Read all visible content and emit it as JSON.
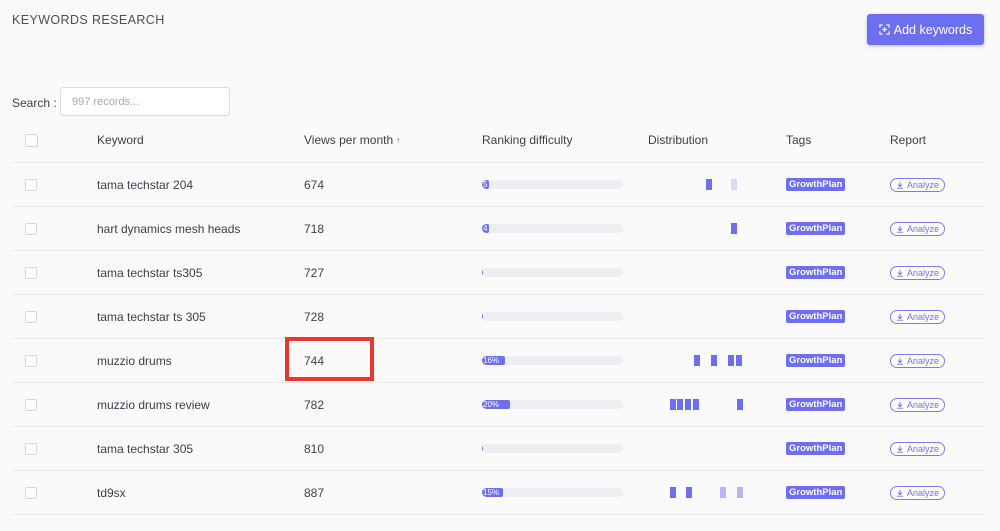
{
  "page": {
    "title": "KEYWORDS RESEARCH"
  },
  "toolbar": {
    "add_label": "Add keywords"
  },
  "search": {
    "label": "Search :",
    "placeholder": "997 records..."
  },
  "table": {
    "columns": {
      "keyword": "Keyword",
      "views": "Views per month",
      "views_sort": "↑",
      "ranking": "Ranking difficulty",
      "distribution": "Distribution",
      "tags": "Tags",
      "report": "Report"
    },
    "rows": [
      {
        "keyword": "tama techstar 204",
        "views": "674",
        "rank_value": 0.05,
        "rank_label": "5",
        "dist": [
          [
            226,
            "dark"
          ],
          [
            251,
            "lighter"
          ]
        ],
        "tag": "GrowthPlan",
        "report": "Analyze"
      },
      {
        "keyword": "hart dynamics mesh heads",
        "views": "718",
        "rank_value": 0.04,
        "rank_label": "4",
        "dist": [
          [
            251,
            "dark"
          ]
        ],
        "tag": "GrowthPlan",
        "report": "Analyze"
      },
      {
        "keyword": "tama techstar ts305",
        "views": "727",
        "rank_value": 0,
        "rank_label": "",
        "dist": [],
        "tag": "GrowthPlan",
        "report": "Analyze"
      },
      {
        "keyword": "tama techstar ts 305",
        "views": "728",
        "rank_value": 0,
        "rank_label": "",
        "dist": [],
        "tag": "GrowthPlan",
        "report": "Analyze"
      },
      {
        "keyword": "muzzio drums",
        "views": "744",
        "rank_value": 0.16,
        "rank_label": "16%",
        "dist": [
          [
            214,
            "dark"
          ],
          [
            231,
            "dark"
          ],
          [
            248,
            "dark"
          ],
          [
            256,
            "dark"
          ]
        ],
        "tag": "GrowthPlan",
        "report": "Analyze"
      },
      {
        "keyword": "muzzio drums review",
        "views": "782",
        "rank_value": 0.2,
        "rank_label": "20%",
        "dist": [
          [
            190,
            "dark"
          ],
          [
            197,
            "dark"
          ],
          [
            205,
            "dark"
          ],
          [
            213,
            "dark"
          ],
          [
            257,
            "dark"
          ]
        ],
        "tag": "GrowthPlan",
        "report": "Analyze"
      },
      {
        "keyword": "tama techstar 305",
        "views": "810",
        "rank_value": 0,
        "rank_label": "",
        "dist": [],
        "tag": "GrowthPlan",
        "report": "Analyze"
      },
      {
        "keyword": "td9sx",
        "views": "887",
        "rank_value": 0.15,
        "rank_label": "15%",
        "dist": [
          [
            190,
            "dark"
          ],
          [
            206,
            "dark"
          ],
          [
            240,
            "light"
          ],
          [
            257,
            "light"
          ]
        ],
        "tag": "GrowthPlan",
        "report": "Analyze"
      }
    ]
  },
  "colors": {
    "accent": "#6c6ff0",
    "highlight": "#e8382e"
  },
  "icons": {
    "add": "scan-plus-icon",
    "download": "download-icon",
    "sort": "arrow-up-icon"
  }
}
